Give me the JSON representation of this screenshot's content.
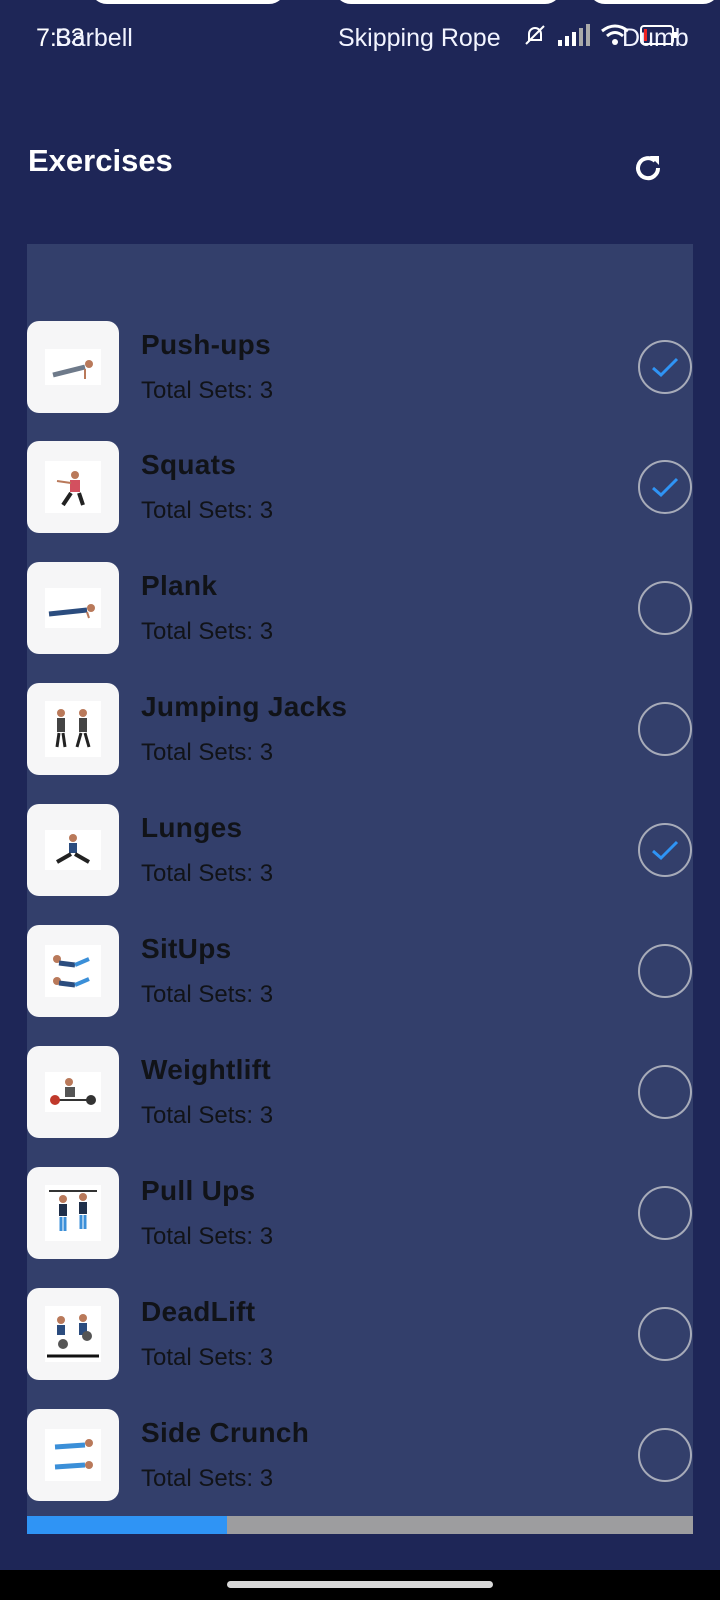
{
  "status_bar": {
    "time": "7:33",
    "chips": [
      "Barbell",
      "Skipping Rope",
      "Dumb"
    ]
  },
  "header": {
    "title": "Exercises",
    "refresh_icon": "refresh-icon"
  },
  "exercises": [
    {
      "name": "Push-ups",
      "sets": "Total Sets: 3",
      "done": true
    },
    {
      "name": "Squats",
      "sets": "Total Sets: 3",
      "done": true
    },
    {
      "name": "Plank",
      "sets": "Total Sets: 3",
      "done": false
    },
    {
      "name": "Jumping Jacks",
      "sets": "Total Sets: 3",
      "done": false
    },
    {
      "name": "Lunges",
      "sets": "Total Sets: 3",
      "done": true
    },
    {
      "name": "SitUps",
      "sets": "Total Sets: 3",
      "done": false
    },
    {
      "name": "Weightlift",
      "sets": "Total Sets: 3",
      "done": false
    },
    {
      "name": "Pull Ups",
      "sets": "Total Sets: 3",
      "done": false
    },
    {
      "name": "DeadLift",
      "sets": "Total Sets: 3",
      "done": false
    },
    {
      "name": "Side Crunch",
      "sets": "Total Sets: 3",
      "done": false
    }
  ],
  "progress": {
    "fraction": 0.3
  },
  "colors": {
    "background": "#1e2657",
    "panel": "#333f6b",
    "accent": "#2f94f5",
    "check_ring": "#a7abb9"
  }
}
